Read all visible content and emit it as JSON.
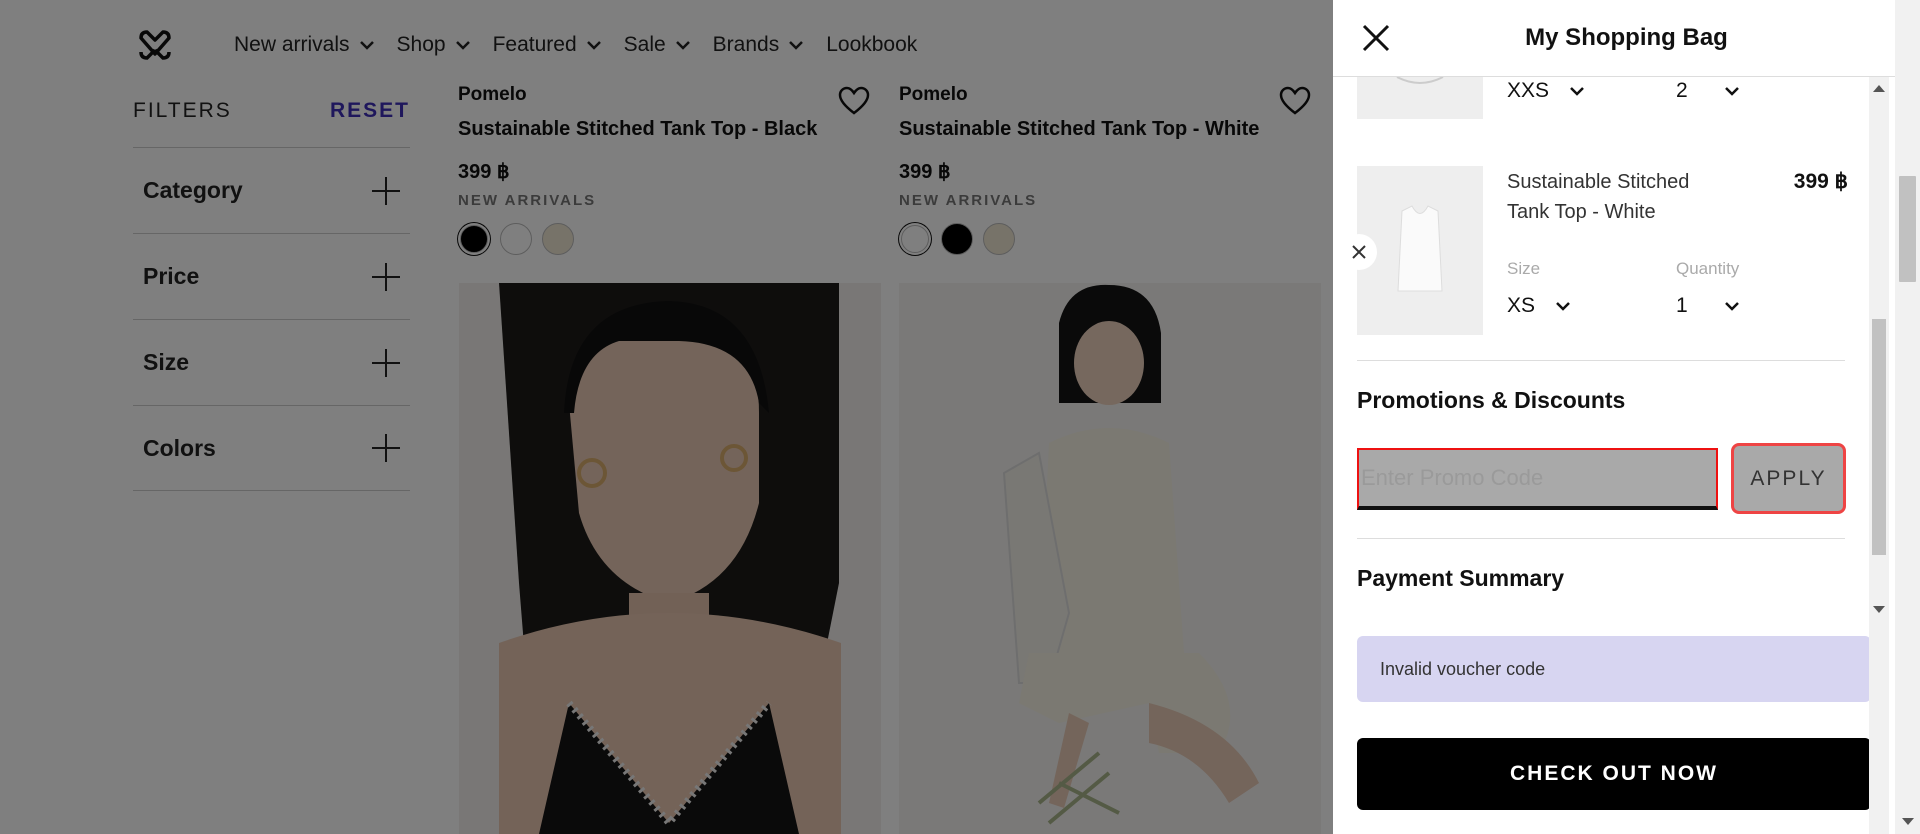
{
  "nav": {
    "items": [
      {
        "label": "New arrivals"
      },
      {
        "label": "Shop"
      },
      {
        "label": "Featured"
      },
      {
        "label": "Sale"
      },
      {
        "label": "Brands"
      },
      {
        "label": "Lookbook"
      }
    ]
  },
  "filters": {
    "title": "FILTERS",
    "reset": "RESET",
    "groups": [
      {
        "label": "Category"
      },
      {
        "label": "Price"
      },
      {
        "label": "Size"
      },
      {
        "label": "Colors"
      }
    ]
  },
  "products": [
    {
      "brand": "Pomelo",
      "name": "Sustainable Stitched Tank Top - Black",
      "price": "399 ฿",
      "tag": "NEW ARRIVALS",
      "swatches": [
        "#000000",
        "#ffffff",
        "#efe6d2"
      ]
    },
    {
      "brand": "Pomelo",
      "name": "Sustainable Stitched Tank Top - White",
      "price": "399 ฿",
      "tag": "NEW ARRIVALS",
      "swatches": [
        "#ffffff",
        "#000000",
        "#efe6d2"
      ]
    }
  ],
  "bag": {
    "title": "My Shopping Bag",
    "items": [
      {
        "size": "XXS",
        "quantity": "2"
      },
      {
        "name": "Sustainable Stitched Tank Top - White",
        "price": "399 ฿",
        "size_label": "Size",
        "size": "XS",
        "quantity_label": "Quantity",
        "quantity": "1"
      }
    ],
    "promotions_title": "Promotions & Discounts",
    "promo_placeholder": "Enter Promo Code",
    "promo_value": "",
    "apply_label": "APPLY",
    "payment_summary_title": "Payment Summary",
    "notice": "Invalid voucher code",
    "checkout_label": "CHECK OUT NOW"
  },
  "colors": {
    "accent": "#3e2fb8",
    "notice_bg": "#d7d5f1",
    "error_border": "#e11111",
    "checkout_bg": "#000000"
  }
}
